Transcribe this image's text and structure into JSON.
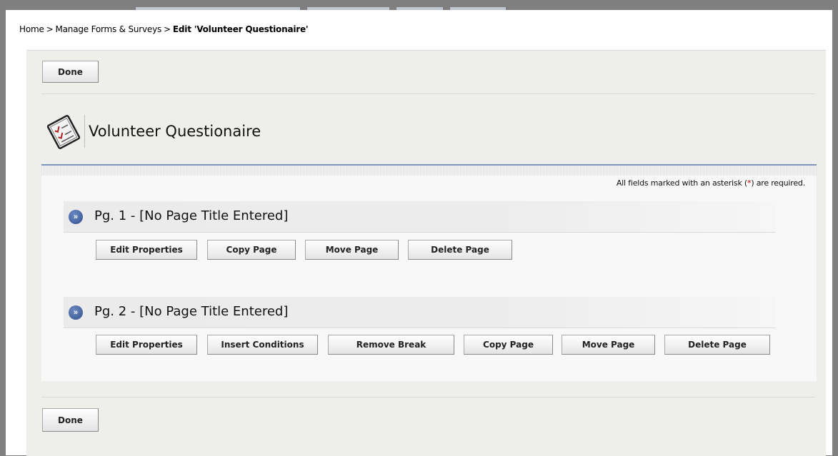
{
  "breadcrumb": {
    "home": "Home",
    "separator": ">",
    "manage": "Manage Forms & Surveys",
    "current": "Edit 'Volunteer Questionaire'"
  },
  "toolbar": {
    "done_top": "Done",
    "done_bottom": "Done"
  },
  "form": {
    "title": "Volunteer Questionaire",
    "icon": "form-checklist-icon"
  },
  "required_note": {
    "before": "All fields marked with an asterisk (",
    "asterisk": "*",
    "after": ") are required."
  },
  "pages": [
    {
      "title": "Pg. 1 - [No Page Title Entered]",
      "buttons": [
        "Edit Properties",
        "Copy Page",
        "Move Page",
        "Delete Page"
      ]
    },
    {
      "title": "Pg. 2 - [No Page Title Entered]",
      "buttons": [
        "Edit Properties",
        "Insert Conditions",
        "Remove Break",
        "Copy Page",
        "Move Page",
        "Delete Page"
      ]
    }
  ],
  "colors": {
    "accent_line": "#7d93bb",
    "asterisk": "#c00000",
    "chevron": "#2f4f8e"
  }
}
